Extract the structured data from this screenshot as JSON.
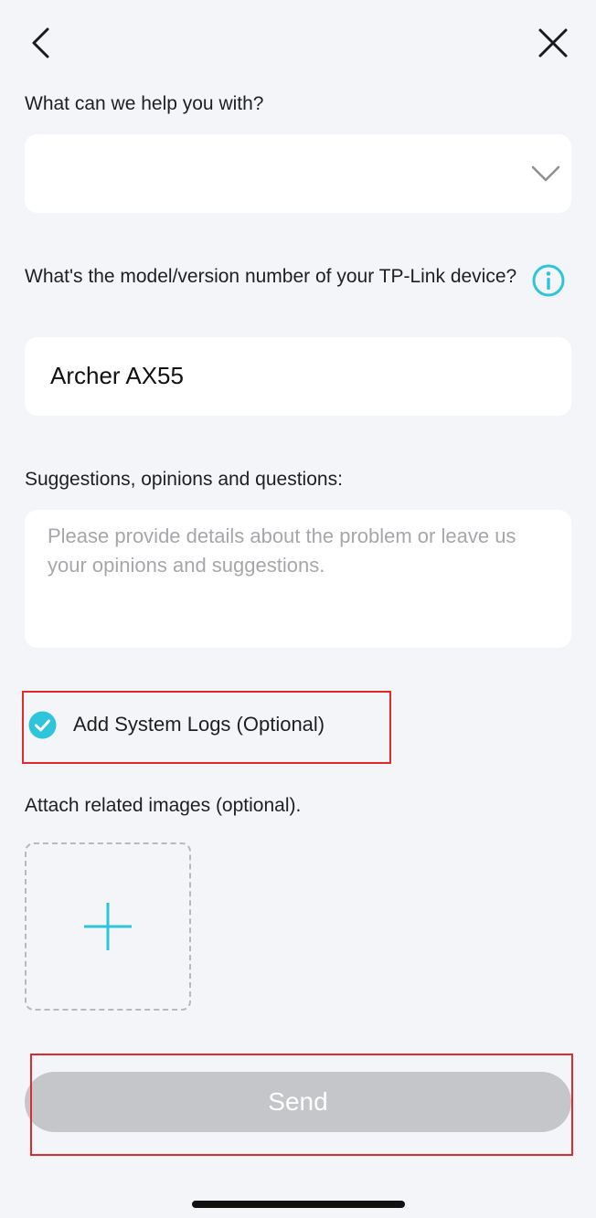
{
  "nav": {
    "back_icon": "chevron-left-icon",
    "close_icon": "close-icon"
  },
  "form": {
    "help_label": "What can we help you with?",
    "help_value": "",
    "model_label": "What's the model/version number of your TP-Link device?",
    "model_value": "Archer AX55",
    "suggestions_label": "Suggestions, opinions and questions:",
    "suggestions_placeholder": "Please provide details about the problem or leave us your opinions and suggestions.",
    "logs_label": "Add System Logs (Optional)",
    "logs_checked": true,
    "attach_label": "Attach related images (optional).",
    "send_label": "Send"
  },
  "colors": {
    "accent": "#2ec4dc",
    "send_disabled": "#c5c6ca",
    "annotation": "#e52828"
  }
}
